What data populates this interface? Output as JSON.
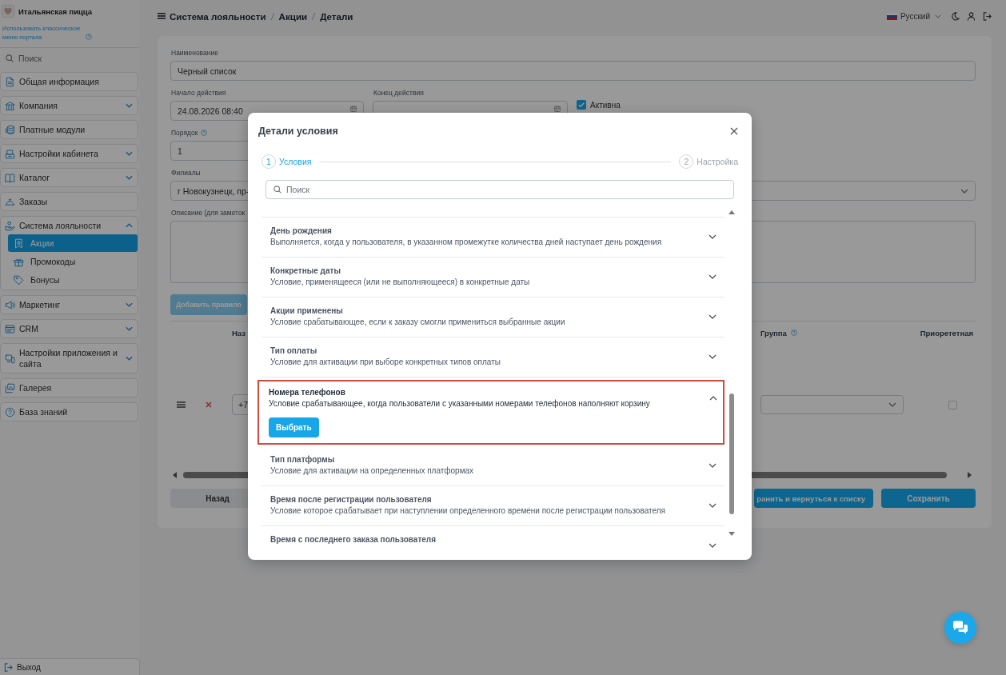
{
  "sidebar": {
    "brand": "Итальянская пицца",
    "classic_menu_link": "Использовать классическое меню портала",
    "search": {
      "placeholder": "Поиск"
    },
    "items": [
      {
        "label": "Общая информация",
        "kind": "link"
      },
      {
        "label": "Компания",
        "kind": "group",
        "expanded": false
      },
      {
        "label": "Платные модули",
        "kind": "link"
      },
      {
        "label": "Настройки кабинета",
        "kind": "group",
        "expanded": false
      },
      {
        "label": "Каталог",
        "kind": "group",
        "expanded": false
      },
      {
        "label": "Заказы",
        "kind": "link"
      },
      {
        "label": "Система лояльности",
        "kind": "group",
        "expanded": true,
        "children": [
          {
            "label": "Акции",
            "selected": true
          },
          {
            "label": "Промокоды",
            "selected": false
          },
          {
            "label": "Бонусы",
            "selected": false
          }
        ]
      },
      {
        "label": "Маркетинг",
        "kind": "group",
        "expanded": false
      },
      {
        "label": "CRM",
        "kind": "group",
        "expanded": false
      },
      {
        "label": "Настройки приложения и сайта",
        "kind": "group",
        "expanded": false
      },
      {
        "label": "Галерея",
        "kind": "link"
      },
      {
        "label": "База знаний",
        "kind": "link"
      }
    ],
    "logout": "Выход"
  },
  "header": {
    "breadcrumbs": [
      "Система лояльности",
      "Акции",
      "Детали"
    ],
    "language": "Русский"
  },
  "form": {
    "name": {
      "label": "Наименование",
      "value": "Черный список"
    },
    "start": {
      "label": "Начало действия",
      "value": "24.08.2026 08:40"
    },
    "end": {
      "label": "Конец действия"
    },
    "active": {
      "label": "Активна",
      "checked": true
    },
    "order": {
      "label": "Порядок",
      "value": "1"
    },
    "branches": {
      "label": "Филиалы",
      "value": "г Новокузнецк, пр-"
    },
    "description": {
      "label": "Описание (для заметок"
    },
    "add_rule_button": "Добавить правило",
    "rules_table": {
      "columns": [
        "Наз",
        "Группа",
        "Приорететная"
      ],
      "rows": [
        {
          "value": "+7",
          "checked": false
        }
      ]
    },
    "buttons": [
      {
        "label": "Назад",
        "kind": "secondary"
      },
      {
        "label": "ранить и вернуться к списку",
        "kind": "primary"
      },
      {
        "label": "Сохранить",
        "kind": "primary"
      }
    ]
  },
  "modal": {
    "title": "Детали условия",
    "steps": [
      {
        "number": "1",
        "label": "Условия",
        "selected": true
      },
      {
        "number": "2",
        "label": "Настройка",
        "selected": false
      }
    ],
    "search": {
      "placeholder": "Поиск"
    },
    "conditions": [
      {
        "title": "День рождения",
        "description": "Выполняется, когда у пользователя, в указанном промежутке количества дней наступает день рождения",
        "expanded": false,
        "highlighted": false
      },
      {
        "title": "Конкретные даты",
        "description": "Условие, применящееся (или не выполняющееся) в конкретные даты",
        "expanded": false,
        "highlighted": false
      },
      {
        "title": "Акции применены",
        "description": "Условие срабатывающее, если к заказу смогли примениться выбранные акции",
        "expanded": false,
        "highlighted": false
      },
      {
        "title": "Тип оплаты",
        "description": "Условие для активации при выборе конкретных типов оплаты",
        "expanded": false,
        "highlighted": false
      },
      {
        "title": "Номера телефонов",
        "description": "Условие срабатывающее, когда пользователи с указанными номерами телефонов наполняют корзину",
        "expanded": true,
        "highlighted": true,
        "action_button": "Выбрать"
      },
      {
        "title": "Тип платформы",
        "description": "Условие для активации на определенных платформах",
        "expanded": false,
        "highlighted": false
      },
      {
        "title": "Время после регистрации пользователя",
        "description": "Условие которое срабатывает при наступлении определенного времени после регистрации пользователя",
        "expanded": false,
        "highlighted": false
      },
      {
        "title": "Время с последнего заказа пользователя",
        "expanded": false,
        "highlighted": false
      }
    ]
  }
}
